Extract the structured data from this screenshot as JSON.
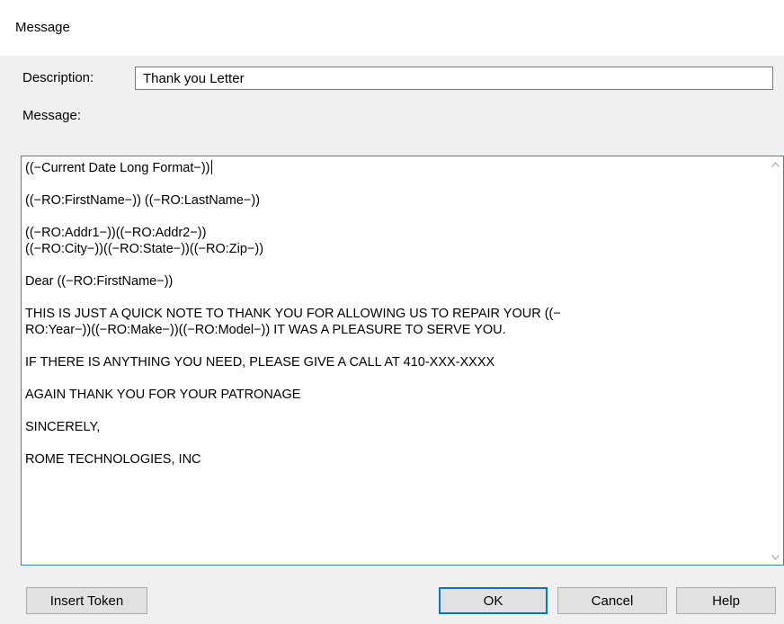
{
  "window": {
    "title": "Message"
  },
  "form": {
    "description_label": "Description:",
    "description_value": "Thank you Letter",
    "message_label": "Message:"
  },
  "message": {
    "body": "((−Current Date Long Format−))\n\n((−RO:FirstName−)) ((−RO:LastName−))\n\n((−RO:Addr1−))((−RO:Addr2−))\n((−RO:City−))((−RO:State−))((−RO:Zip−))\n\nDear ((−RO:FirstName−))\n\nTHIS IS JUST A QUICK NOTE TO THANK YOU FOR ALLOWING US TO REPAIR YOUR ((−\nRO:Year−))((−RO:Make−))((−RO:Model−)) IT WAS A PLEASURE TO SERVE YOU.\n\nIF THERE IS ANYTHING YOU NEED, PLEASE GIVE A CALL AT 410-XXX-XXXX\n\nAGAIN THANK YOU FOR YOUR PATRONAGE\n\nSINCERELY,\n\nROME TECHNOLOGIES, INC"
  },
  "buttons": {
    "insert_token": "Insert Token",
    "ok": "OK",
    "cancel": "Cancel",
    "help": "Help"
  },
  "icons": {
    "scroll_up": "chevron-up-icon",
    "scroll_down": "chevron-down-icon"
  },
  "colors": {
    "focus_border": "#3b7fd6",
    "default_button_border": "#0078d7",
    "button_face": "#e1e1e1",
    "dialog_bg": "#f0f0f0"
  }
}
